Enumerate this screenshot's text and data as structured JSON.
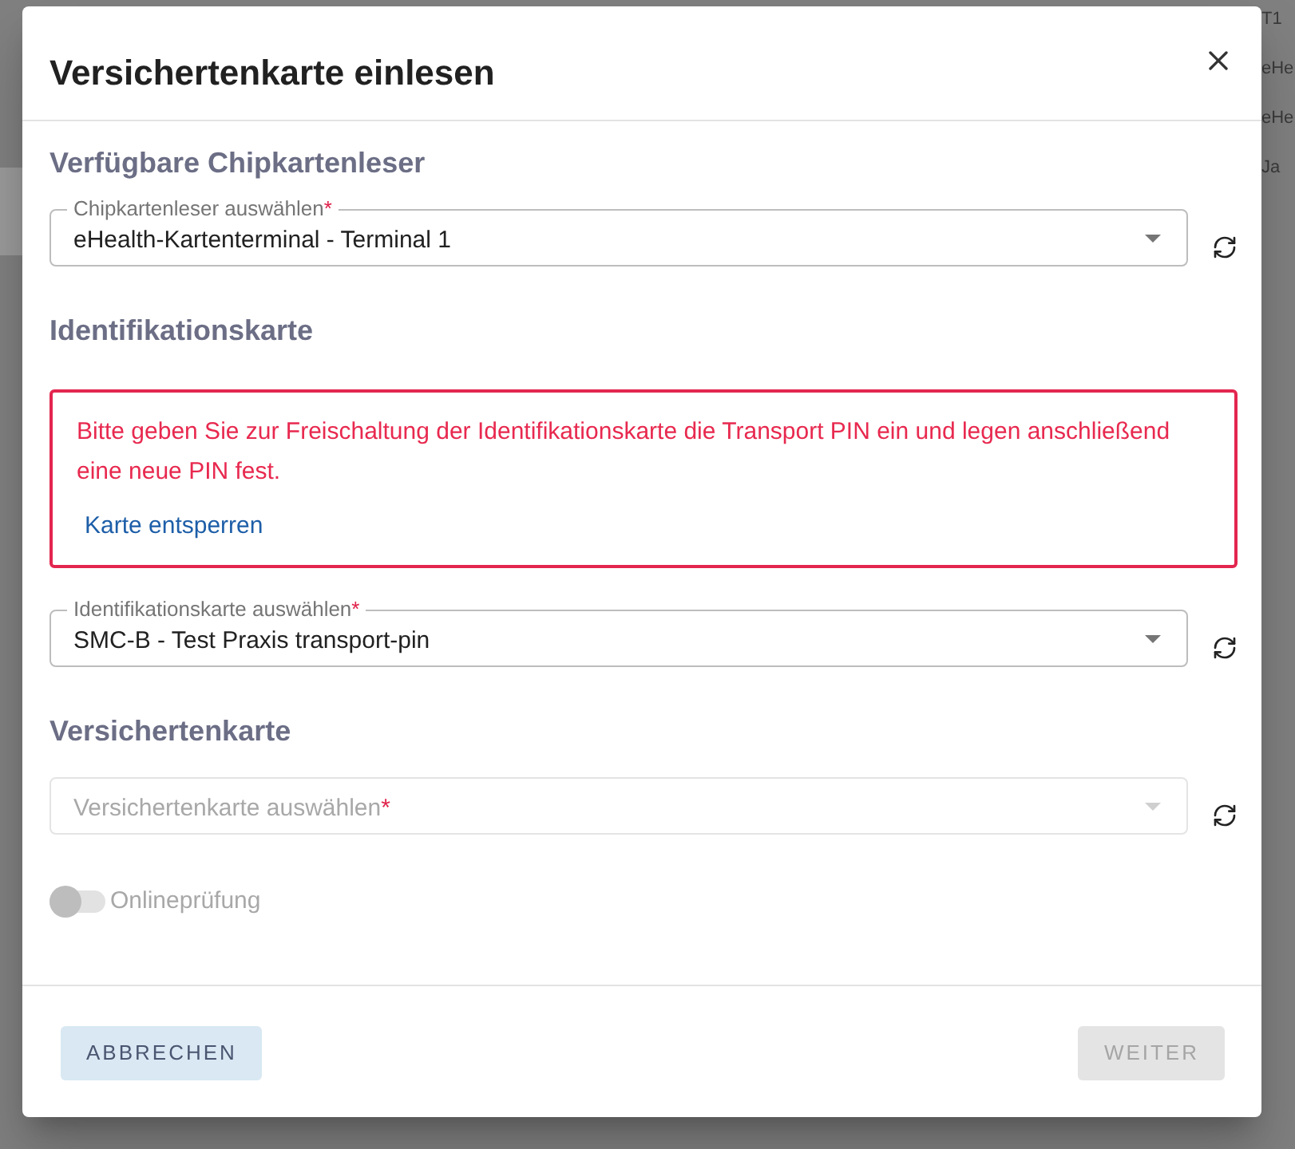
{
  "background": {
    "texts": [
      "T1",
      "eHe",
      "eHe",
      "Ja"
    ]
  },
  "dialog": {
    "title": "Versichertenkarte einlesen",
    "body": [
      {
        "kind": "heading",
        "text": "Verfügbare Chipkartenleser"
      },
      {
        "kind": "select",
        "label": "Chipkartenleser auswählen",
        "required_mark": "*",
        "value": "eHealth-Kartenterminal - Terminal 1",
        "disabled": false
      },
      {
        "kind": "heading",
        "text": "Identifikationskarte"
      },
      {
        "kind": "alert",
        "message": "Bitte geben Sie zur Freischaltung der Identifikationskarte die Transport PIN ein und legen anschließend eine neue PIN fest.",
        "link": "Karte entsperren"
      },
      {
        "kind": "select",
        "label": "Identifikationskarte auswählen",
        "required_mark": "*",
        "value": "SMC-B - Test Praxis transport-pin",
        "disabled": false
      },
      {
        "kind": "heading",
        "text": "Versichertenkarte"
      },
      {
        "kind": "select",
        "label": "Versichertenkarte auswählen",
        "required_mark": "*",
        "disabled": true
      },
      {
        "kind": "toggle",
        "label": "Onlineprüfung",
        "on": false,
        "disabled": true
      }
    ],
    "buttons": [
      {
        "kind": "secondary",
        "label": "ABBRECHEN",
        "disabled": false
      },
      {
        "kind": "primary",
        "label": "WEITER",
        "disabled": true
      }
    ]
  }
}
